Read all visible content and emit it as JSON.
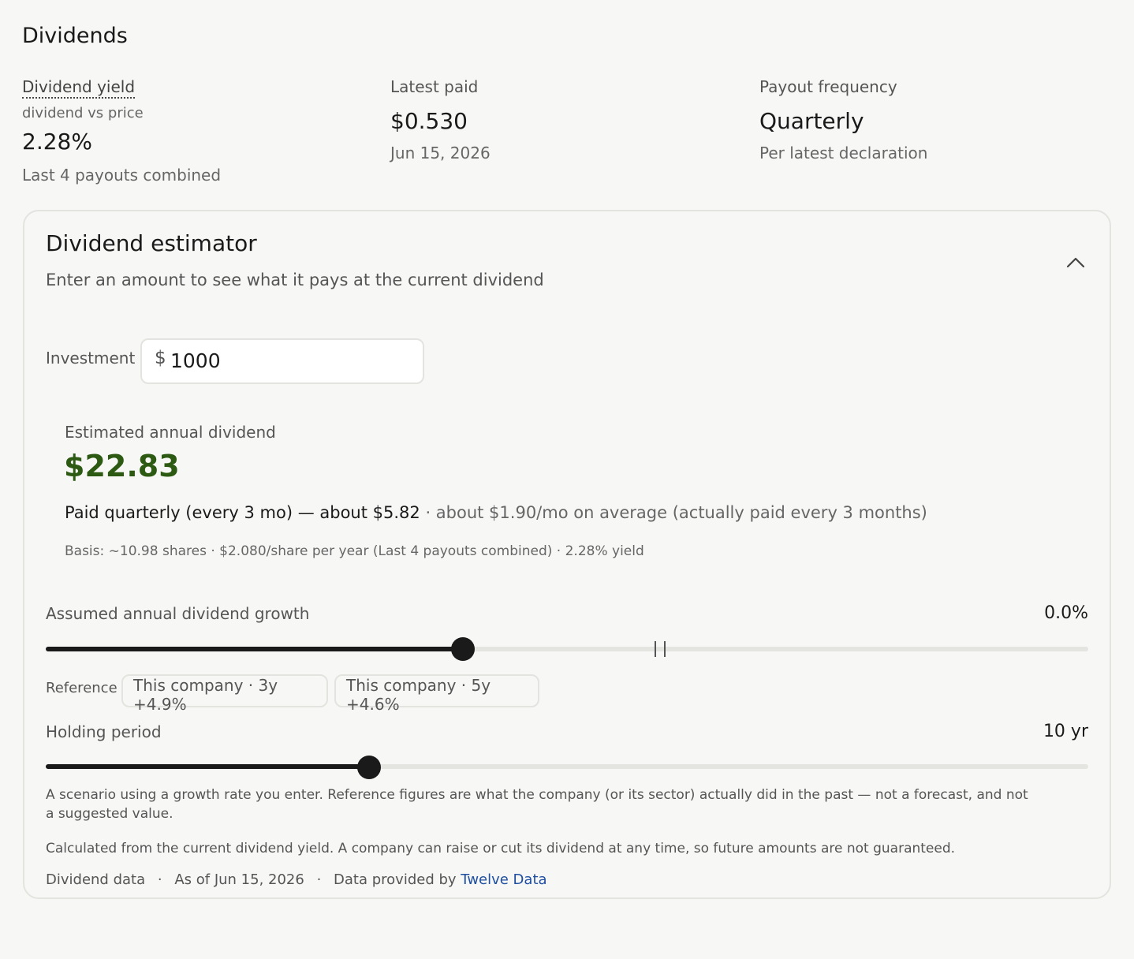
{
  "section_title": "Dividends",
  "stats": {
    "yield": {
      "label": "Dividend yield",
      "sub": "dividend vs price",
      "value": "2.28%",
      "note": "Last 4 payouts combined"
    },
    "latest": {
      "label": "Latest paid",
      "value": "$0.530",
      "note": "Jun 15, 2026"
    },
    "frequency": {
      "label": "Payout frequency",
      "value": "Quarterly",
      "note": "Per latest declaration"
    }
  },
  "estimator": {
    "title": "Dividend estimator",
    "subtitle": "Enter an amount to see what it pays at the current dividend",
    "investment_label": "Investment",
    "currency": "$",
    "investment_value": "1000",
    "annual_label": "Estimated annual dividend",
    "annual_value": "$22.83",
    "per_payment": "Paid quarterly (every 3 mo) — about $5.82",
    "per_month": " · about $1.90/mo on average (actually paid every 3 months)",
    "basis": "Basis: ~10.98 shares · $2.080/share per year (Last 4 payouts combined) · 2.28% yield",
    "growth": {
      "label": "Assumed annual dividend growth",
      "value_text": "0.0%",
      "value_fraction": 0.4
    },
    "reference": {
      "label": "Reference",
      "chips": [
        "This company · 3y +4.9%",
        "This company · 5y +4.6%"
      ]
    },
    "holding": {
      "label": "Holding period",
      "value_text": "10 yr",
      "value_fraction": 0.31
    },
    "disclaimer": "A scenario using a growth rate you enter. Reference figures are what the company (or its sector) actually did in the past — not a forecast, and not a suggested value.",
    "disclaimer2": "Calculated from the current dividend yield. A company can raise or cut its dividend at any time, so future amounts are not guaranteed.",
    "footer": {
      "source": "Dividend data",
      "separator": "·",
      "as_of": "As of Jun 15, 2026",
      "provider_prefix": "Data provided by",
      "provider_link": "Twelve Data"
    }
  },
  "colors": {
    "accent_green": "#2d5a13",
    "link_blue": "#1f4fa0"
  }
}
